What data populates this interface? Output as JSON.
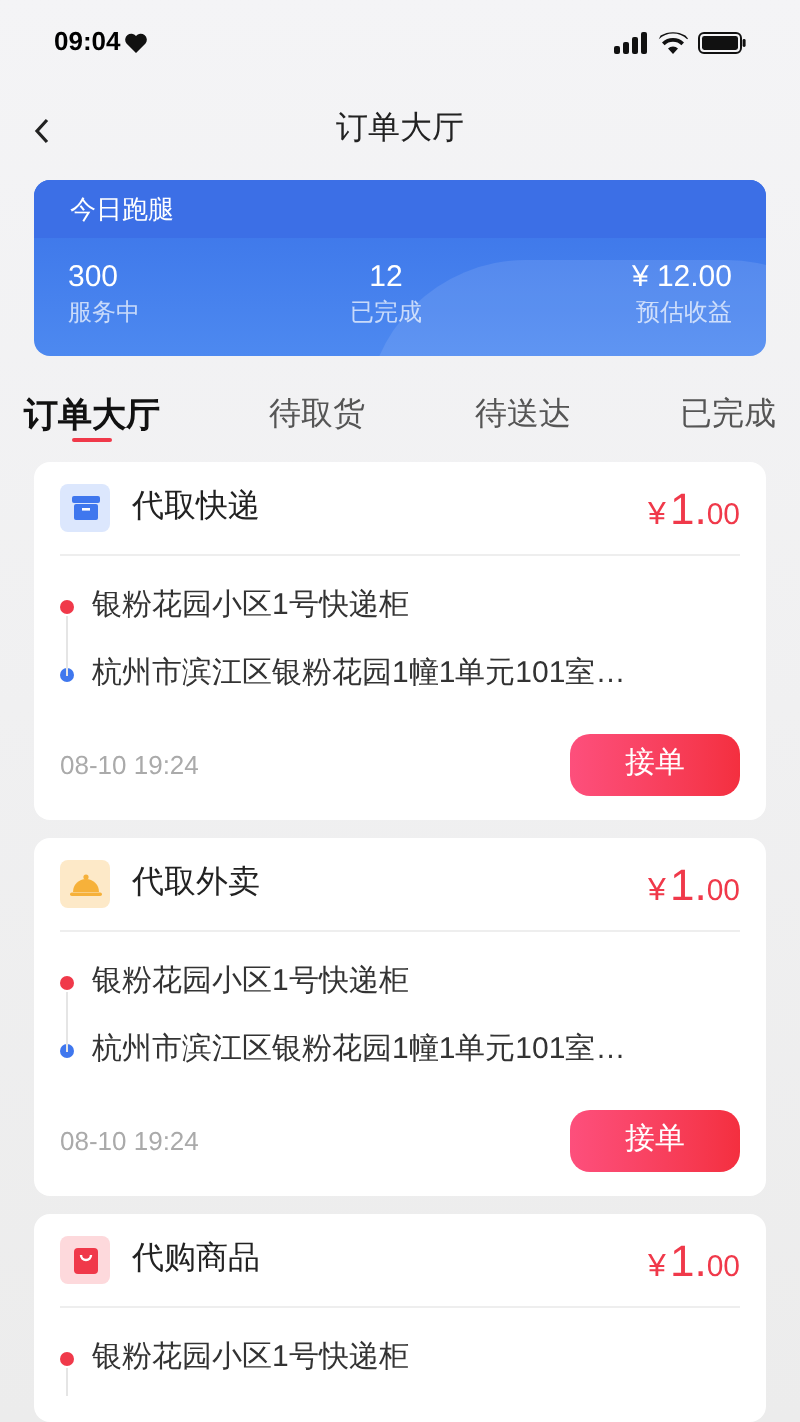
{
  "status_bar": {
    "time": "09:04"
  },
  "nav": {
    "title": "订单大厅"
  },
  "summary": {
    "title": "今日跑腿",
    "stats": [
      {
        "value": "300",
        "label": "服务中"
      },
      {
        "value": "12",
        "label": "已完成"
      },
      {
        "value": "¥ 12.00",
        "label": "预估收益"
      }
    ]
  },
  "tabs": [
    {
      "label": "订单大厅",
      "selected": true
    },
    {
      "label": "待取货",
      "selected": false
    },
    {
      "label": "待送达",
      "selected": false
    },
    {
      "label": "已完成",
      "selected": false
    }
  ],
  "orders": [
    {
      "kind": "box",
      "title": "代取快递",
      "price_symbol": "¥",
      "price_integer": "1.",
      "price_decimal": "00",
      "pickup": "银粉花园小区1号快递柜",
      "dropoff": "杭州市滨江区银粉花园1幢1单元101室…",
      "time": "08-10 19:24",
      "button": "接单"
    },
    {
      "kind": "food",
      "title": "代取外卖",
      "price_symbol": "¥",
      "price_integer": "1.",
      "price_decimal": "00",
      "pickup": "银粉花园小区1号快递柜",
      "dropoff": "杭州市滨江区银粉花园1幢1单元101室…",
      "time": "08-10 19:24",
      "button": "接单"
    },
    {
      "kind": "bag",
      "title": "代购商品",
      "price_symbol": "¥",
      "price_integer": "1.",
      "price_decimal": "00",
      "pickup": "银粉花园小区1号快递柜"
    }
  ]
}
